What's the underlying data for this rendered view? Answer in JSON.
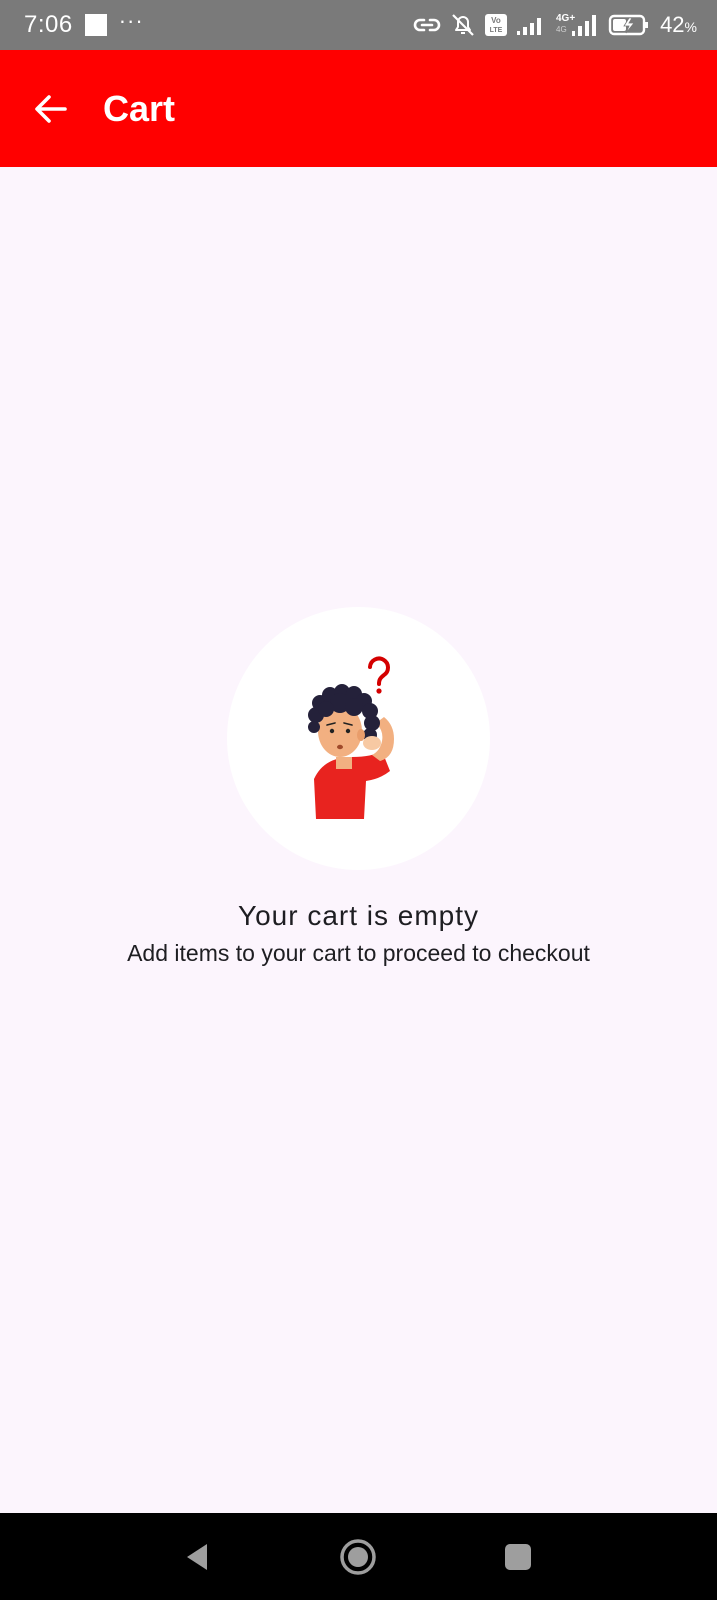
{
  "status_bar": {
    "time": "7:06",
    "battery_percent": "42",
    "battery_unit": "%",
    "network_label": "4G+",
    "icons": [
      "notification-square",
      "more-dots",
      "link-icon",
      "bell-off-icon",
      "volte-icon",
      "signal-icon",
      "signal-4g-icon",
      "battery-charging-icon"
    ]
  },
  "app_bar": {
    "title": "Cart",
    "back_icon": "arrow-left-icon",
    "color": "#ff0000"
  },
  "empty_state": {
    "illustration": "confused-person-illustration",
    "title": "Your cart is empty",
    "subtitle": "Add items to your cart to proceed to checkout"
  },
  "nav_bar": {
    "buttons": [
      "back-triangle-icon",
      "home-circle-icon",
      "recents-square-icon"
    ]
  }
}
